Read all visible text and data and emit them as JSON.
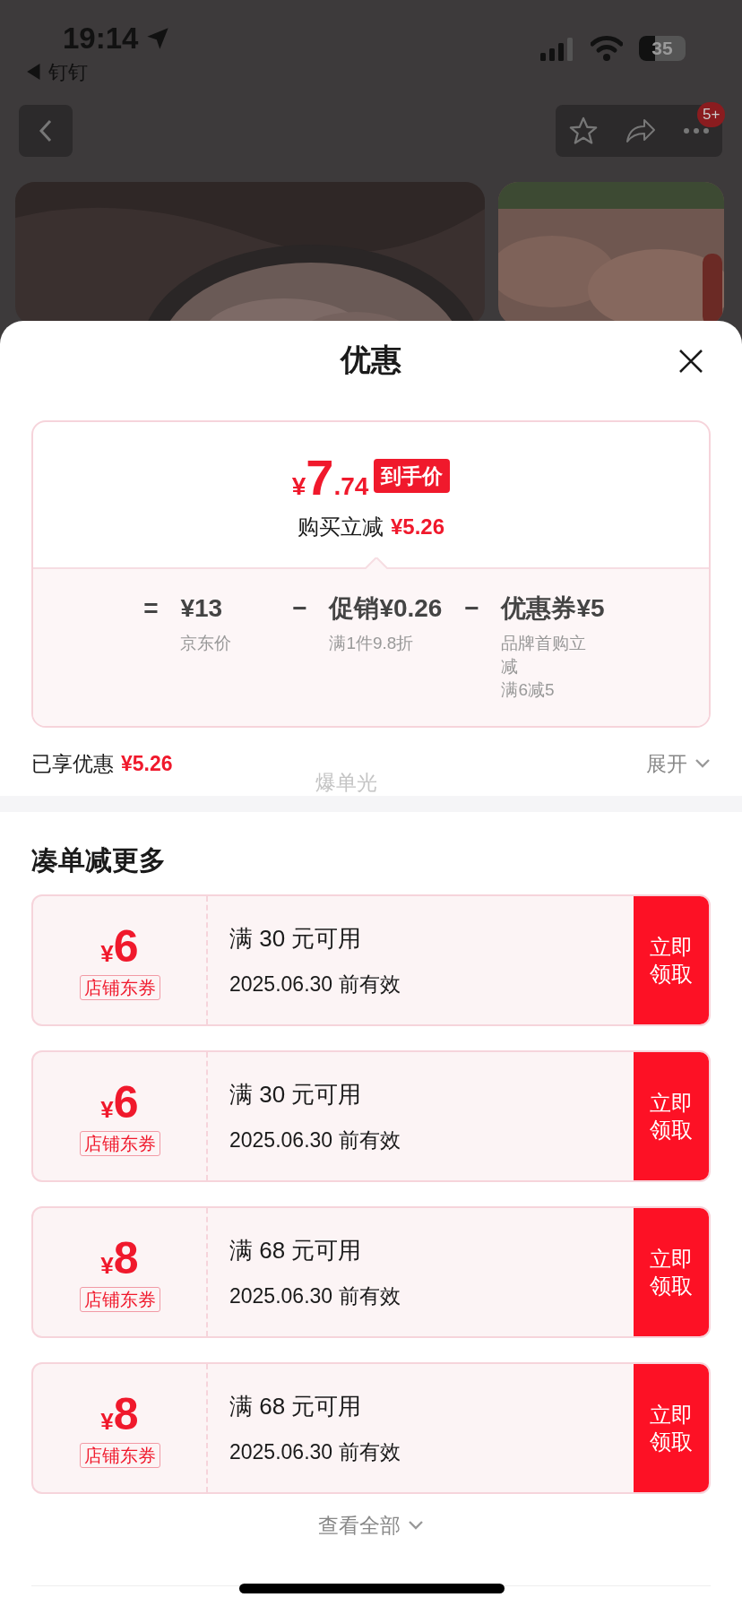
{
  "status_bar": {
    "time": "19:14",
    "back_app": "◀ 钉钉",
    "battery": "35"
  },
  "nav": {
    "badge": "5+"
  },
  "sheet": {
    "title": "优惠",
    "price_card": {
      "currency": "¥",
      "price_int": "7",
      "price_dec": ".74",
      "price_tag": "到手价",
      "saving_label": "购买立减",
      "saving_value": "¥5.26",
      "formula": [
        {
          "kind": "op",
          "text": "="
        },
        {
          "kind": "term",
          "text": "¥13",
          "notes": [
            "京东价"
          ]
        },
        {
          "kind": "op",
          "text": "−"
        },
        {
          "kind": "term",
          "text": "促销¥0.26",
          "notes": [
            "满1件9.8折"
          ]
        },
        {
          "kind": "op",
          "text": "−"
        },
        {
          "kind": "term",
          "text": "优惠券¥5",
          "notes": [
            "品牌首购立减",
            "满6减5"
          ]
        }
      ]
    },
    "enjoyed": {
      "label": "已享优惠",
      "value": "¥5.26",
      "faint": "爆单光",
      "expand": "展开"
    },
    "section_title": "凑单减更多",
    "coupons": [
      {
        "currency": "¥",
        "amount": "6",
        "type": "店铺东券",
        "condition": "满 30 元可用",
        "validity": "2025.06.30 前有效",
        "action": "立即领取"
      },
      {
        "currency": "¥",
        "amount": "6",
        "type": "店铺东券",
        "condition": "满 30 元可用",
        "validity": "2025.06.30 前有效",
        "action": "立即领取"
      },
      {
        "currency": "¥",
        "amount": "8",
        "type": "店铺东券",
        "condition": "满 68 元可用",
        "validity": "2025.06.30 前有效",
        "action": "立即领取"
      },
      {
        "currency": "¥",
        "amount": "8",
        "type": "店铺东券",
        "condition": "满 68 元可用",
        "validity": "2025.06.30 前有效",
        "action": "立即领取"
      }
    ],
    "view_all": "查看全部"
  }
}
